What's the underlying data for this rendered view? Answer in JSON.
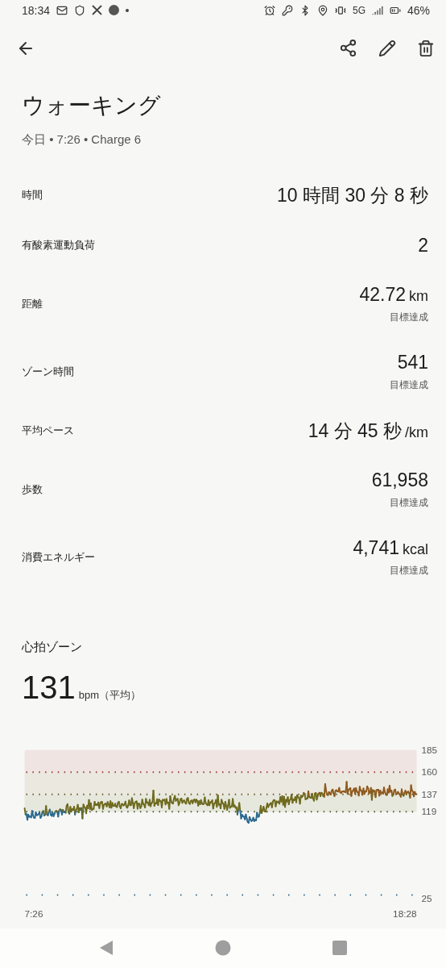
{
  "status_bar": {
    "time": "18:34",
    "network": "5G",
    "battery": "46%"
  },
  "title": "ウォーキング",
  "subtitle": "今日 • 7:26 • Charge 6",
  "metrics": [
    {
      "label": "時間",
      "value": "10 時間 30 分 8 秒"
    },
    {
      "label": "有酸素運動負荷",
      "value": "2"
    },
    {
      "label": "距離",
      "value": "42.72",
      "unit": "km",
      "note": "目標達成"
    },
    {
      "label": "ゾーン時間",
      "value": "541",
      "note": "目標達成"
    },
    {
      "label": "平均ペース",
      "value": "14 分 45 秒",
      "unit": "/km"
    },
    {
      "label": "歩数",
      "value": "61,958",
      "note": "目標達成"
    },
    {
      "label": "消費エネルギー",
      "value": "4,741",
      "unit": "kcal",
      "note": "目標達成"
    }
  ],
  "heart": {
    "title": "心拍ゾーン",
    "value": "131",
    "unit": "bpm（平均）",
    "y_labels": [
      "185",
      "160",
      "137",
      "119",
      "25"
    ],
    "x_labels": [
      "7:26",
      "18:28"
    ]
  }
}
